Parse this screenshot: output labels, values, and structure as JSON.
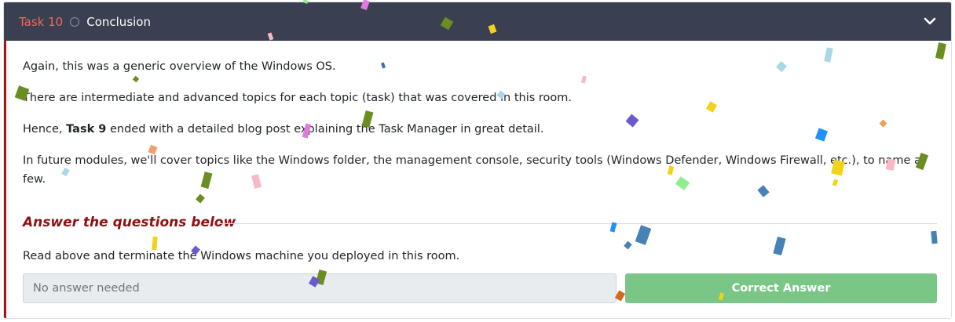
{
  "task": {
    "number_label": "Task 10",
    "title": "Conclusion"
  },
  "content": {
    "paragraph_1": "Again, this was a generic overview of the Windows OS.",
    "paragraph_2": "There are intermediate and advanced topics for each topic (task) that was covered in this room.",
    "paragraph_3_prefix": "Hence, ",
    "paragraph_3_bold": "Task 9",
    "paragraph_3_suffix": " ended with a detailed blog post explaining the Task Manager in great detail.",
    "paragraph_4": "In future modules, we'll cover topics like the Windows folder, the management console, security tools (Windows Defender, Windows Firewall, etc.), to name a few."
  },
  "questions": {
    "heading": "Answer the questions below",
    "question_1": "Read above and terminate the Windows machine you deployed in this room.",
    "answer_placeholder": "No answer needed",
    "submit_label": "Correct Answer"
  },
  "colors": {
    "header_bg": "#3a4051",
    "task_number": "#f0695a",
    "accent_border": "#b00f0f",
    "heading": "#8e1010",
    "correct_button": "#79c687"
  },
  "icons": {
    "status": "circle-outline-icon",
    "collapse": "chevron-down-icon"
  }
}
